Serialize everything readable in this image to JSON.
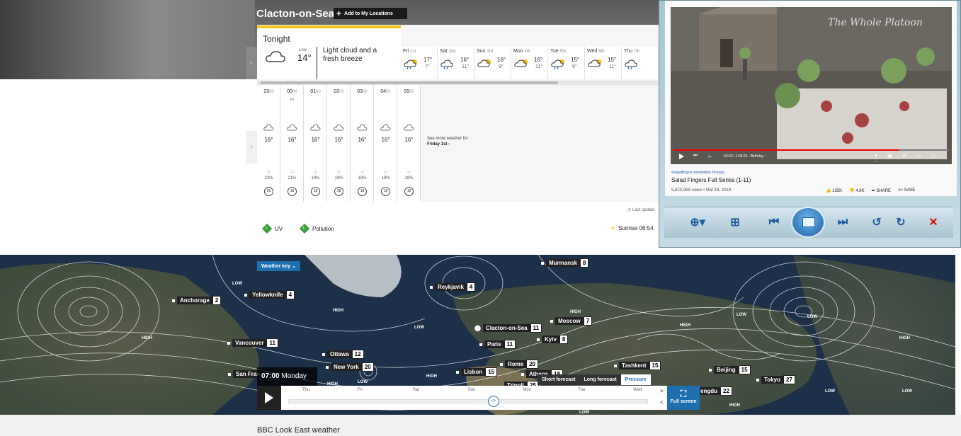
{
  "header": {
    "location": "Clacton-on-Sea",
    "add_location": "Add to My Locations"
  },
  "tonight": {
    "title": "Tonight",
    "low_label": "Low",
    "low_value": "14°",
    "description": "Light cloud and a fresh breeze"
  },
  "days": [
    {
      "name": "Fri",
      "date": "1st",
      "hi": "17°",
      "lo": "7°",
      "icon": "sun-cloud-rain-icon"
    },
    {
      "name": "Sat",
      "date": "2nd",
      "hi": "16°",
      "lo": "11°",
      "icon": "cloud-rain-icon"
    },
    {
      "name": "Sun",
      "date": "3rd",
      "hi": "16°",
      "lo": "9°",
      "icon": "sun-cloud-icon"
    },
    {
      "name": "Mon",
      "date": "4th",
      "hi": "16°",
      "lo": "11°",
      "icon": "sun-cloud-icon"
    },
    {
      "name": "Tue",
      "date": "5th",
      "hi": "15°",
      "lo": "9°",
      "icon": "sun-cloud-rain-icon"
    },
    {
      "name": "Wed",
      "date": "6th",
      "hi": "15°",
      "lo": "11°",
      "icon": "sun-cloud-icon"
    },
    {
      "name": "Thu",
      "date": "7th",
      "hi": "",
      "lo": "",
      "icon": "cloud-rain-icon"
    }
  ],
  "hours": [
    {
      "h": "23",
      "m": "00",
      "sub": "",
      "temp": "16°",
      "pct": "23%",
      "wind": "20"
    },
    {
      "h": "00",
      "m": "00",
      "sub": "Fri",
      "temp": "16°",
      "pct": "21%",
      "wind": "19"
    },
    {
      "h": "01",
      "m": "00",
      "sub": "",
      "temp": "16°",
      "pct": "19%",
      "wind": "18"
    },
    {
      "h": "02",
      "m": "00",
      "sub": "",
      "temp": "16°",
      "pct": "19%",
      "wind": "18"
    },
    {
      "h": "03",
      "m": "00",
      "sub": "",
      "temp": "16°",
      "pct": "19%",
      "wind": "18"
    },
    {
      "h": "04",
      "m": "00",
      "sub": "",
      "temp": "16°",
      "pct": "19%",
      "wind": "18"
    },
    {
      "h": "05",
      "m": "00",
      "sub": "",
      "temp": "16°",
      "pct": "18%",
      "wind": "19"
    }
  ],
  "see_more": {
    "line1": "See more weather for",
    "line2": "Friday 1st"
  },
  "last_updated": "Last update",
  "uv": {
    "badge": "L",
    "label": "UV"
  },
  "pollution": {
    "badge": "L",
    "label": "Pollution"
  },
  "sunrise": "Sunrise 06:54",
  "map": {
    "weather_key": "Weather key",
    "cities": [
      {
        "name": "Murmansk",
        "temp": "8"
      },
      {
        "name": "Reykjavik",
        "temp": "4"
      },
      {
        "name": "Anchorage",
        "temp": "2"
      },
      {
        "name": "Yellowknife",
        "temp": "4"
      },
      {
        "name": "Clacton-on-Sea",
        "temp": "11"
      },
      {
        "name": "Moscow",
        "temp": "7"
      },
      {
        "name": "Paris",
        "temp": "11"
      },
      {
        "name": "Kyiv",
        "temp": "8"
      },
      {
        "name": "Vancouver",
        "temp": "11"
      },
      {
        "name": "Ottawa",
        "temp": "12"
      },
      {
        "name": "New York",
        "temp": "20"
      },
      {
        "name": "Rome",
        "temp": "20"
      },
      {
        "name": "Lisbon",
        "temp": "15"
      },
      {
        "name": "Athens",
        "temp": "18"
      },
      {
        "name": "Tashkent",
        "temp": "15"
      },
      {
        "name": "Beijing",
        "temp": "15"
      },
      {
        "name": "Tokyo",
        "temp": "27"
      },
      {
        "name": "San Fran",
        "temp": ""
      },
      {
        "name": "Tripoli",
        "temp": "25"
      },
      {
        "name": "engdu",
        "temp": "22"
      }
    ],
    "pressure_labels": [
      "LOW",
      "HIGH",
      "HIGH",
      "LOW",
      "HIGH",
      "LOW",
      "HIGH",
      "HIGH",
      "LOW",
      "HIGH",
      "LOW",
      "LOW",
      "HIGH",
      "LOW",
      "LOW",
      "HIGH"
    ]
  },
  "player": {
    "time": "07:00",
    "day": "Monday",
    "timeline_days": [
      "Thu",
      "Fri",
      "Sat",
      "Sun",
      "Mon",
      "Tue",
      "Wed"
    ],
    "tabs": [
      "Short forecast",
      "Long forecast",
      "Pressure"
    ],
    "fullscreen": "Full screen"
  },
  "footer": {
    "title": "BBC Look East weather"
  },
  "viewer": {
    "watermark": "The Whole Platoon",
    "video_time": "50:23 / 1:06:25 · Birthday ›",
    "tags": "#saladfingers #animation #creepy",
    "title": "Salad Fingers Full Series (1-11)",
    "meta": "5,823,968 views • Mar 18, 2019",
    "likes": "135K",
    "dislikes": "4.8K",
    "share": "SHARE",
    "save": "SAVE"
  }
}
